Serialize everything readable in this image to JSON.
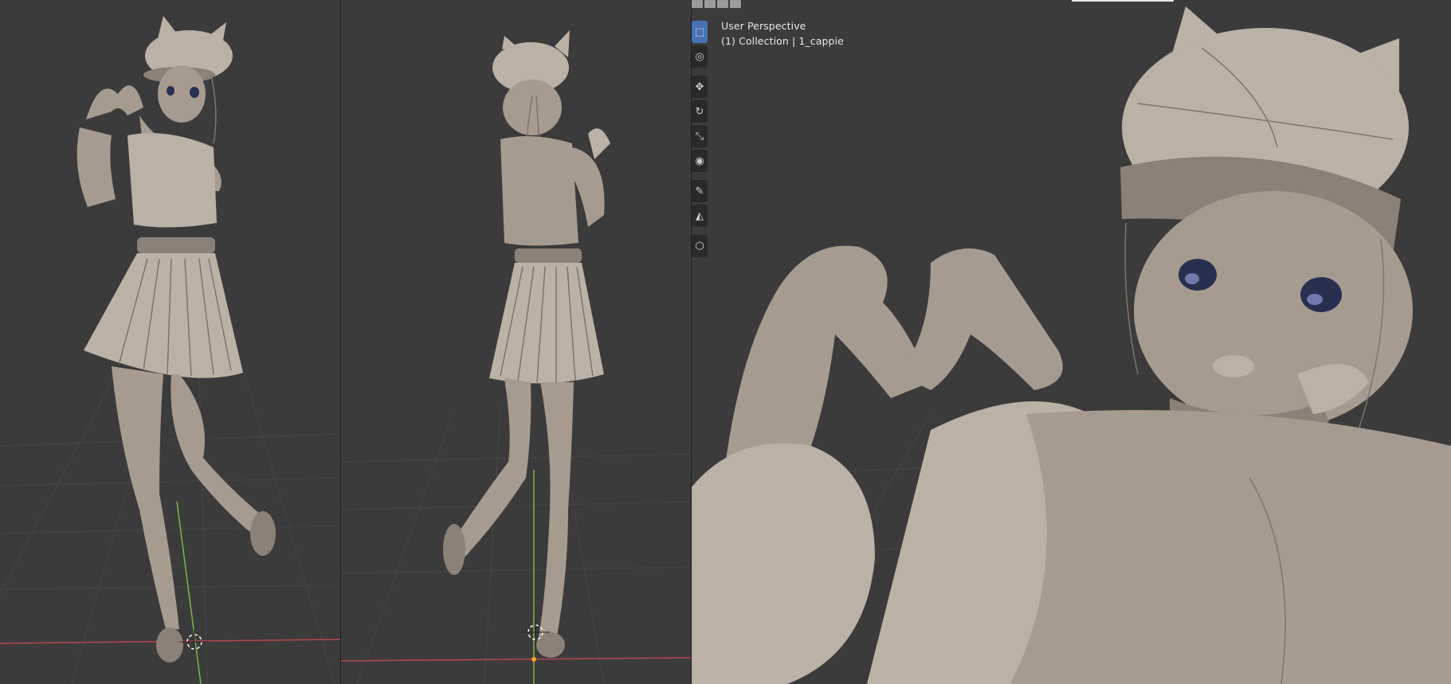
{
  "viewport": {
    "title": "User Perspective",
    "collection": "(1) Collection | 1_cappie"
  },
  "toolbar": {
    "tools": [
      {
        "name": "select-box-icon",
        "glyph": "⬚",
        "active": true
      },
      {
        "name": "cursor-icon",
        "glyph": "◎",
        "active": false
      },
      {
        "name": "move-icon",
        "glyph": "✥",
        "active": false
      },
      {
        "name": "rotate-icon",
        "glyph": "↻",
        "active": false
      },
      {
        "name": "scale-icon",
        "glyph": "⤡",
        "active": false
      },
      {
        "name": "transform-icon",
        "glyph": "◉",
        "active": false
      },
      {
        "name": "annotate-icon",
        "glyph": "✎",
        "active": false
      },
      {
        "name": "measure-icon",
        "glyph": "◭",
        "active": false
      },
      {
        "name": "add-cube-icon",
        "glyph": "⬡",
        "active": false
      }
    ]
  },
  "colors": {
    "viewport_bg": "#3b3b3b",
    "clay": "#a79b90",
    "x_axis": "#b5454d",
    "y_axis": "#7fb44a",
    "active_tool": "#4772b3"
  }
}
